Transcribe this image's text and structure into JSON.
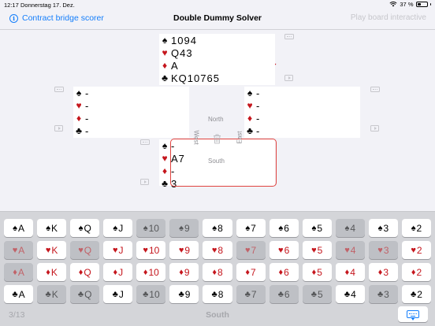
{
  "status": {
    "time": "12:17",
    "date": "Donnerstag 17. Dez.",
    "battery": "37 %",
    "battery_level": 0.37
  },
  "nav": {
    "back_label": "Contract bridge scorer",
    "title": "Double Dummy Solver",
    "action_label": "Play board interactive"
  },
  "compass": {
    "north": "North",
    "south": "South",
    "west": "West",
    "east": "East"
  },
  "icons": {
    "suits": {
      "spade": "♠",
      "heart": "♥",
      "diamond": "♦",
      "club": "♣"
    },
    "checkmark": "✔"
  },
  "colors": {
    "accent": "#147efb",
    "red": "#c5161d",
    "selected_border": "#e0433f"
  },
  "hands": {
    "north": {
      "spades": "1094",
      "hearts": "Q43",
      "diamonds": "A",
      "clubs": "KQ10765"
    },
    "west": {
      "spades": "-",
      "hearts": "-",
      "diamonds": "-",
      "clubs": "-"
    },
    "east": {
      "spades": "-",
      "hearts": "-",
      "diamonds": "-",
      "clubs": "-"
    },
    "south": {
      "spades": "-",
      "hearts": "A7",
      "diamonds": "-",
      "clubs": "3"
    }
  },
  "grid": [
    {
      "suit": "♠",
      "color": "black",
      "cards": [
        {
          "rank": "A",
          "dim": false
        },
        {
          "rank": "K",
          "dim": false
        },
        {
          "rank": "Q",
          "dim": false
        },
        {
          "rank": "J",
          "dim": false
        },
        {
          "rank": "10",
          "dim": true
        },
        {
          "rank": "9",
          "dim": true
        },
        {
          "rank": "8",
          "dim": false
        },
        {
          "rank": "7",
          "dim": false
        },
        {
          "rank": "6",
          "dim": false
        },
        {
          "rank": "5",
          "dim": false
        },
        {
          "rank": "4",
          "dim": true
        },
        {
          "rank": "3",
          "dim": false
        },
        {
          "rank": "2",
          "dim": false
        }
      ]
    },
    {
      "suit": "♥",
      "color": "red",
      "cards": [
        {
          "rank": "A",
          "dim": true
        },
        {
          "rank": "K",
          "dim": false
        },
        {
          "rank": "Q",
          "dim": true
        },
        {
          "rank": "J",
          "dim": false
        },
        {
          "rank": "10",
          "dim": false
        },
        {
          "rank": "9",
          "dim": false
        },
        {
          "rank": "8",
          "dim": false
        },
        {
          "rank": "7",
          "dim": true
        },
        {
          "rank": "6",
          "dim": false
        },
        {
          "rank": "5",
          "dim": false
        },
        {
          "rank": "4",
          "dim": true
        },
        {
          "rank": "3",
          "dim": true
        },
        {
          "rank": "2",
          "dim": false
        }
      ]
    },
    {
      "suit": "♦",
      "color": "red",
      "cards": [
        {
          "rank": "A",
          "dim": true
        },
        {
          "rank": "K",
          "dim": false
        },
        {
          "rank": "Q",
          "dim": false
        },
        {
          "rank": "J",
          "dim": false
        },
        {
          "rank": "10",
          "dim": false
        },
        {
          "rank": "9",
          "dim": false
        },
        {
          "rank": "8",
          "dim": false
        },
        {
          "rank": "7",
          "dim": false
        },
        {
          "rank": "6",
          "dim": false
        },
        {
          "rank": "5",
          "dim": false
        },
        {
          "rank": "4",
          "dim": false
        },
        {
          "rank": "3",
          "dim": false
        },
        {
          "rank": "2",
          "dim": false
        }
      ]
    },
    {
      "suit": "♣",
      "color": "black",
      "cards": [
        {
          "rank": "A",
          "dim": false
        },
        {
          "rank": "K",
          "dim": true
        },
        {
          "rank": "Q",
          "dim": true
        },
        {
          "rank": "J",
          "dim": false
        },
        {
          "rank": "10",
          "dim": true
        },
        {
          "rank": "9",
          "dim": false
        },
        {
          "rank": "8",
          "dim": false
        },
        {
          "rank": "7",
          "dim": true
        },
        {
          "rank": "6",
          "dim": true
        },
        {
          "rank": "5",
          "dim": true
        },
        {
          "rank": "4",
          "dim": false
        },
        {
          "rank": "3",
          "dim": true
        },
        {
          "rank": "2",
          "dim": false
        }
      ]
    }
  ],
  "bottom": {
    "progress": "3/13",
    "seat": "South"
  }
}
